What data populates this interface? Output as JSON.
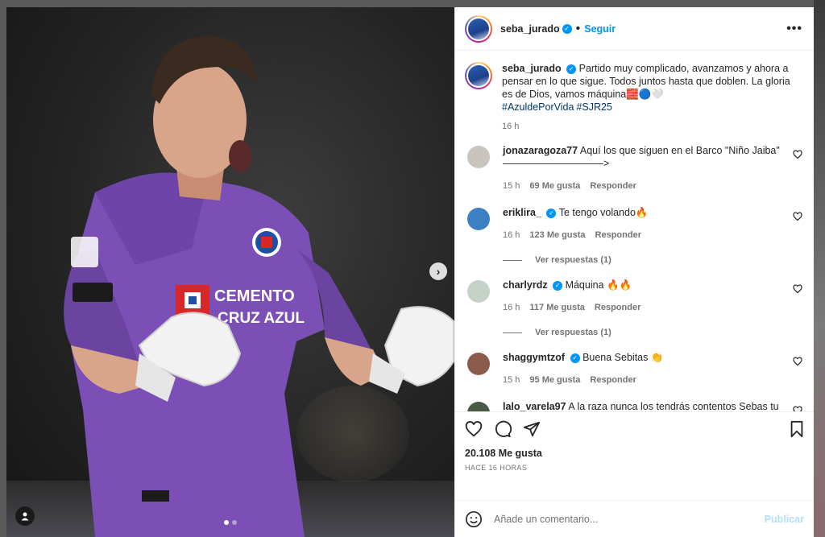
{
  "post": {
    "username": "seba_jurado",
    "follow_label": "Seguir",
    "more_label": "•••",
    "verified_mark": "✓"
  },
  "caption": {
    "username": "seba_jurado",
    "text": "Partido muy complicado, avanzamos y ahora a pensar en lo que sigue. Todos juntos hasta que doblen. La gloria es de Dios, vamos máquina🧱🔵🤍",
    "hashtags": [
      "#AzuldePorVida",
      "#SJR25"
    ],
    "time": "16 h"
  },
  "comments": [
    {
      "username": "jonazaragoza77",
      "verified": false,
      "text": "Aquí los que siguen en el Barco \"Niño Jaiba\" ——————————>",
      "time": "15 h",
      "likes": "69 Me gusta",
      "reply": "Responder",
      "avatar_color": "#c9c4be"
    },
    {
      "username": "eriklira_",
      "verified": true,
      "text": "Te tengo volando🔥",
      "time": "16 h",
      "likes": "123 Me gusta",
      "reply": "Responder",
      "view_replies": "Ver respuestas (1)",
      "avatar_color": "#3d7fc4"
    },
    {
      "username": "charlyrdz",
      "verified": true,
      "text": "Máquina 🔥🔥",
      "time": "16 h",
      "likes": "117 Me gusta",
      "reply": "Responder",
      "view_replies": "Ver respuestas (1)",
      "avatar_color": "#c4d2c8"
    },
    {
      "username": "shaggymtzof",
      "verified": true,
      "text": "Buena Sebitas 👏",
      "time": "15 h",
      "likes": "95 Me gusta",
      "reply": "Responder",
      "avatar_color": "#8a5a4a"
    },
    {
      "username": "lalo_varela97",
      "verified": false,
      "text": "A la raza nunca los tendrás contentos Sebas tu sigue adelante we, chale eres de los pocos vigentes del Tibu 🤍",
      "time": "",
      "likes": "",
      "reply": "",
      "avatar_color": "#4a5a44"
    }
  ],
  "engagement": {
    "likes_total": "20.108 Me gusta",
    "date": "HACE 16 HORAS"
  },
  "add_comment": {
    "placeholder": "Añade un comentario...",
    "publish_label": "Publicar"
  },
  "photo": {
    "jersey_sponsor_line1": "CEMENTO",
    "jersey_sponsor_line2": "CRUZ AZUL",
    "jersey_color": "#7b4fb5",
    "next_label": "›",
    "slide_count": 2,
    "active_slide": 0
  }
}
